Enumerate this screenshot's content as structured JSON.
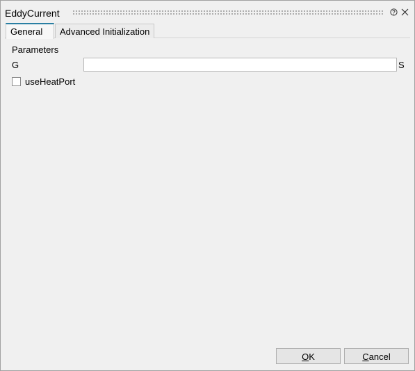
{
  "window": {
    "title": "EddyCurrent",
    "help_icon": "help-icon",
    "close_icon": "close-icon"
  },
  "tabs": [
    {
      "label": "General",
      "active": true
    },
    {
      "label": "Advanced Initialization",
      "active": false
    }
  ],
  "parameters": {
    "section_label": "Parameters",
    "g": {
      "label": "G",
      "value": "",
      "unit": "S"
    },
    "use_heat_port": {
      "label": "useHeatPort",
      "checked": false
    }
  },
  "buttons": {
    "ok": {
      "label": "OK",
      "mnemonic": "O"
    },
    "cancel": {
      "label": "Cancel",
      "mnemonic": "C"
    }
  },
  "colors": {
    "active_tab_accent": "#2a7fa3",
    "background": "#f0f0f0"
  }
}
